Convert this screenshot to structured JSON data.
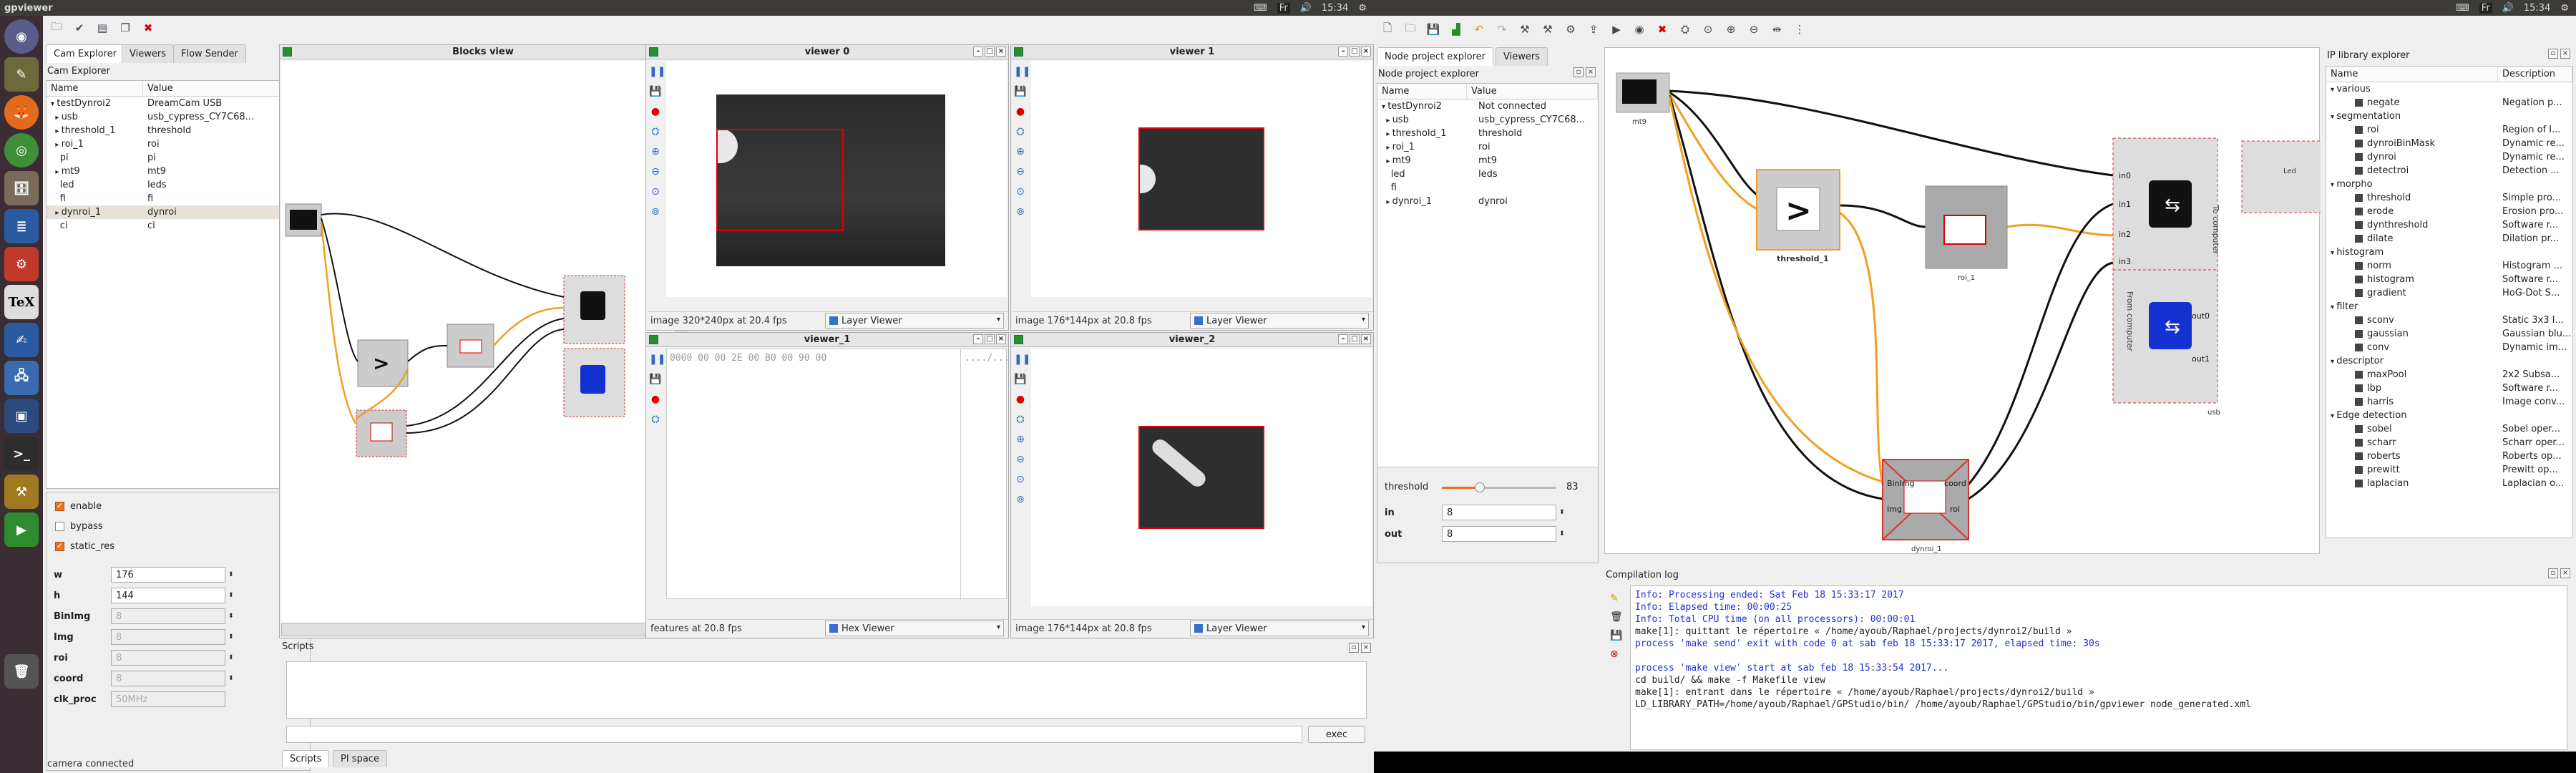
{
  "system": {
    "clock_left": "15:34",
    "clock_right": "15:34",
    "lang": "Fr"
  },
  "window": {
    "title": "gpviewer"
  },
  "camExplorer": {
    "tabs": [
      "Cam Explorer",
      "Viewers",
      "Flow Sender"
    ],
    "header": "Cam Explorer",
    "col_name": "Name",
    "col_value": "Value",
    "rows": [
      {
        "n": "testDynroi2",
        "v": "DreamCam USB"
      },
      {
        "n": "usb",
        "v": "usb_cypress_CY7C68..."
      },
      {
        "n": "threshold_1",
        "v": "threshold"
      },
      {
        "n": "roi_1",
        "v": "roi"
      },
      {
        "n": "pi",
        "v": "pi"
      },
      {
        "n": "mt9",
        "v": "mt9"
      },
      {
        "n": "led",
        "v": "leds"
      },
      {
        "n": "fi",
        "v": "fi"
      },
      {
        "n": "dynroi_1",
        "v": "dynroi"
      },
      {
        "n": "ci",
        "v": "ci"
      }
    ]
  },
  "props": {
    "enable": "enable",
    "bypass": "bypass",
    "static_res": "static_res",
    "fields": [
      {
        "label": "w",
        "value": "176",
        "disabled": false
      },
      {
        "label": "h",
        "value": "144",
        "disabled": false
      },
      {
        "label": "BinImg",
        "value": "8",
        "disabled": true
      },
      {
        "label": "Img",
        "value": "8",
        "disabled": true
      },
      {
        "label": "roi",
        "value": "8",
        "disabled": true
      },
      {
        "label": "coord",
        "value": "8",
        "disabled": true
      },
      {
        "label": "clk_proc",
        "value": "50MHz",
        "disabled": true
      }
    ]
  },
  "statusbar": "camera connected",
  "blocksView": {
    "title": "Blocks view"
  },
  "viewer0": {
    "title": "viewer 0",
    "status": "image 320*240px at 20.4 fps",
    "mode": "Layer Viewer"
  },
  "viewer1": {
    "title": "viewer 1",
    "status": "image 176*144px at 20.8 fps",
    "mode": "Layer Viewer"
  },
  "viewerHex": {
    "title": "viewer_1",
    "status": "features at 20.8 fps",
    "mode": "Hex Viewer",
    "hexline": "0000  00 00 2E 00 B0 00 90 00",
    "ascii": "..../....."
  },
  "viewer2": {
    "title": "viewer_2",
    "status": "image 176*144px at 20.8 fps",
    "mode": "Layer Viewer"
  },
  "scripts": {
    "title": "Scripts",
    "exec": "exec",
    "tabs": [
      "Scripts",
      "PI space"
    ]
  },
  "nodeExplorer": {
    "tabs": [
      "Node project explorer",
      "Viewers"
    ],
    "header": "Node project explorer",
    "col_name": "Name",
    "col_value": "Value",
    "rows": [
      {
        "n": "testDynroi2",
        "v": "Not connected"
      },
      {
        "n": "usb",
        "v": "usb_cypress_CY7C68..."
      },
      {
        "n": "threshold_1",
        "v": "threshold"
      },
      {
        "n": "roi_1",
        "v": "roi"
      },
      {
        "n": "mt9",
        "v": "mt9"
      },
      {
        "n": "led",
        "v": "leds"
      },
      {
        "n": "fi",
        "v": ""
      },
      {
        "n": "dynroi_1",
        "v": "dynroi"
      }
    ]
  },
  "nodeProps": {
    "threshold_label": "threshold",
    "threshold_value": "83",
    "threshold_fraction": 0.33,
    "in_label": "in",
    "in_value": "8",
    "out_label": "out",
    "out_value": "8"
  },
  "graph": {
    "blocks": {
      "mt9": "mt9",
      "threshold": "threshold_1",
      "roi": "roi_1",
      "usb": "usb",
      "led_label": "Led",
      "led": "led",
      "dynroi": "dynroi_1"
    },
    "ports": {
      "in0": "in0",
      "in1": "in1",
      "in2": "in2",
      "in3": "in3",
      "out0": "out0",
      "out1": "out1",
      "binimg": "BinImg",
      "img": "Img",
      "coord": "coord",
      "roi": "roi"
    },
    "usb_to": "To computer",
    "usb_from": "From computer"
  },
  "compile": {
    "title": "Compilation log",
    "lines_info": [
      "Info: Processing ended: Sat Feb 18 15:33:17 2017",
      "Info: Elapsed time: 00:00:25",
      "Info: Total CPU time (on all processors): 00:00:01"
    ],
    "line_make": "make[1]: quittant le répertoire « /home/ayoub/Raphael/projects/dynroi2/build »",
    "line_exit": "process 'make send' exit with code 0 at sab feb 18 15:33:17 2017, elapsed time: 30s",
    "line_start": "process 'make view' start at sab feb 18 15:33:54 2017...",
    "lines_tail": [
      "cd build/ && make -f Makefile view",
      "make[1]: entrant dans le répertoire « /home/ayoub/Raphael/projects/dynroi2/build »",
      "LD_LIBRARY_PATH=/home/ayoub/Raphael/GPStudio/bin/ /home/ayoub/Raphael/GPStudio/bin/gpviewer node_generated.xml"
    ]
  },
  "iplib": {
    "title": "IP library explorer",
    "col_name": "Name",
    "col_desc": "Description",
    "items": [
      {
        "indent": 0,
        "n": "various",
        "d": "",
        "cat": true
      },
      {
        "indent": 1,
        "n": "negate",
        "d": "Negation p...",
        "cat": false
      },
      {
        "indent": 0,
        "n": "segmentation",
        "d": "",
        "cat": true
      },
      {
        "indent": 1,
        "n": "roi",
        "d": "Region of I...",
        "cat": false
      },
      {
        "indent": 1,
        "n": "dynroiBinMask",
        "d": "Dynamic re...",
        "cat": false
      },
      {
        "indent": 1,
        "n": "dynroi",
        "d": "Dynamic re...",
        "cat": false
      },
      {
        "indent": 1,
        "n": "detectroi",
        "d": "Detection ...",
        "cat": false
      },
      {
        "indent": 0,
        "n": "morpho",
        "d": "",
        "cat": true
      },
      {
        "indent": 1,
        "n": "threshold",
        "d": "Simple pro...",
        "cat": false
      },
      {
        "indent": 1,
        "n": "erode",
        "d": "Erosion pro...",
        "cat": false
      },
      {
        "indent": 1,
        "n": "dynthreshold",
        "d": "Software r...",
        "cat": false
      },
      {
        "indent": 1,
        "n": "dilate",
        "d": "Dilation pr...",
        "cat": false
      },
      {
        "indent": 0,
        "n": "histogram",
        "d": "",
        "cat": true
      },
      {
        "indent": 1,
        "n": "norm",
        "d": "Histogram ...",
        "cat": false
      },
      {
        "indent": 1,
        "n": "histogram",
        "d": "Software r...",
        "cat": false
      },
      {
        "indent": 1,
        "n": "gradient",
        "d": "HoG-Dot S...",
        "cat": false
      },
      {
        "indent": 0,
        "n": "filter",
        "d": "",
        "cat": true
      },
      {
        "indent": 1,
        "n": "sconv",
        "d": "Static 3x3 I...",
        "cat": false
      },
      {
        "indent": 1,
        "n": "gaussian",
        "d": "Gaussian blu...",
        "cat": false
      },
      {
        "indent": 1,
        "n": "conv",
        "d": "Dynamic im...",
        "cat": false
      },
      {
        "indent": 0,
        "n": "descriptor",
        "d": "",
        "cat": true
      },
      {
        "indent": 1,
        "n": "maxPool",
        "d": "2x2 Subsa...",
        "cat": false
      },
      {
        "indent": 1,
        "n": "lbp",
        "d": "Software r...",
        "cat": false
      },
      {
        "indent": 1,
        "n": "harris",
        "d": "Image conv...",
        "cat": false
      },
      {
        "indent": 0,
        "n": "Edge detection",
        "d": "",
        "cat": true
      },
      {
        "indent": 1,
        "n": "sobel",
        "d": "Sobel oper...",
        "cat": false
      },
      {
        "indent": 1,
        "n": "scharr",
        "d": "Scharr oper...",
        "cat": false
      },
      {
        "indent": 1,
        "n": "roberts",
        "d": "Roberts op...",
        "cat": false
      },
      {
        "indent": 1,
        "n": "prewitt",
        "d": "Prewitt op...",
        "cat": false
      },
      {
        "indent": 1,
        "n": "laplacian",
        "d": "Laplacian o...",
        "cat": false
      }
    ]
  },
  "colors": {
    "accent": "#f07020",
    "wire_orange": "#f0a020",
    "link_blue": "#2050d0"
  }
}
